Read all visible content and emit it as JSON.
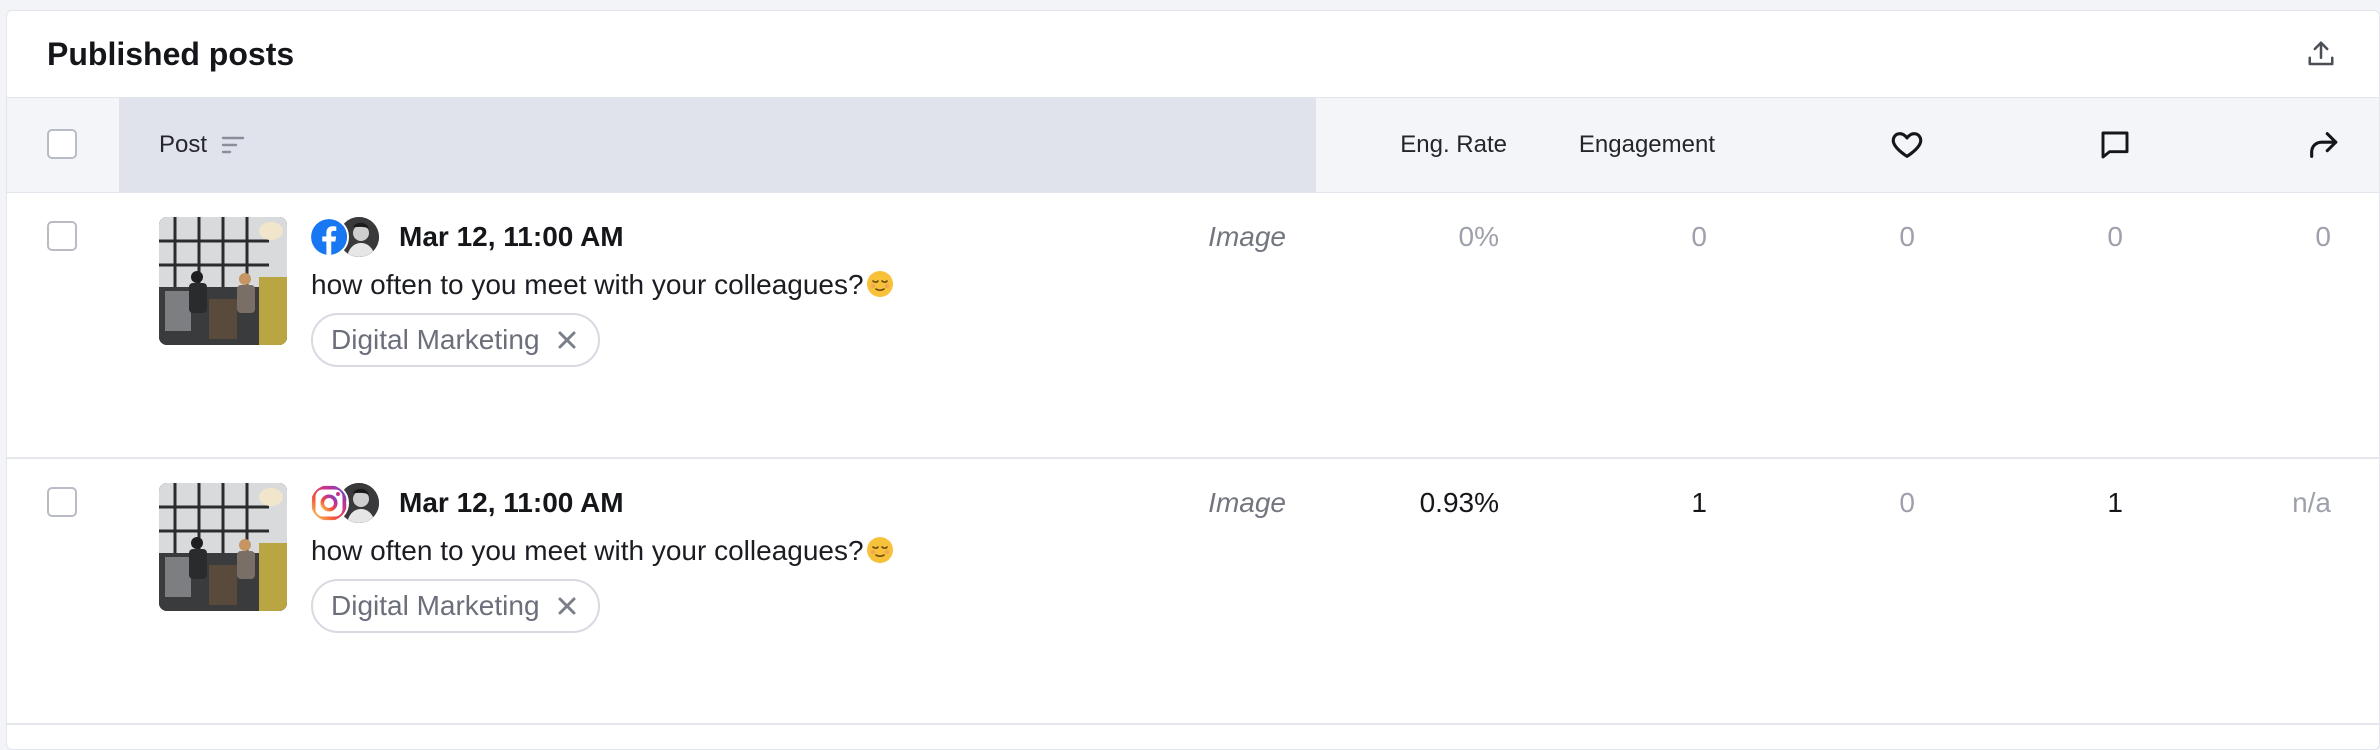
{
  "card": {
    "title": "Published posts",
    "export_icon": "upload-icon"
  },
  "table": {
    "columns": {
      "post": "Post",
      "eng_rate": "Eng. Rate",
      "engagement": "Engagement",
      "likes_icon": "heart-icon",
      "comments_icon": "comment-icon",
      "shares_icon": "share-icon"
    },
    "rows": [
      {
        "network": "facebook",
        "date": "Mar 12, 11:00 AM",
        "text": "how often to you meet with your colleagues?",
        "emoji": "relieved-face",
        "tag": "Digital Marketing",
        "type": "Image",
        "eng_rate": "0%",
        "engagement": "0",
        "likes": "0",
        "comments": "0",
        "shares": "0"
      },
      {
        "network": "instagram",
        "date": "Mar 12, 11:00 AM",
        "text": "how often to you meet with your colleagues?",
        "emoji": "relieved-face",
        "tag": "Digital Marketing",
        "type": "Image",
        "eng_rate": "0.93%",
        "engagement": "1",
        "likes": "0",
        "comments": "1",
        "shares": "n/a"
      }
    ]
  },
  "colors": {
    "facebook": "#1877f2",
    "header_bg": "#f4f5f9",
    "post_header_bg": "#e1e3ec",
    "muted_text": "#9ea1ab"
  }
}
